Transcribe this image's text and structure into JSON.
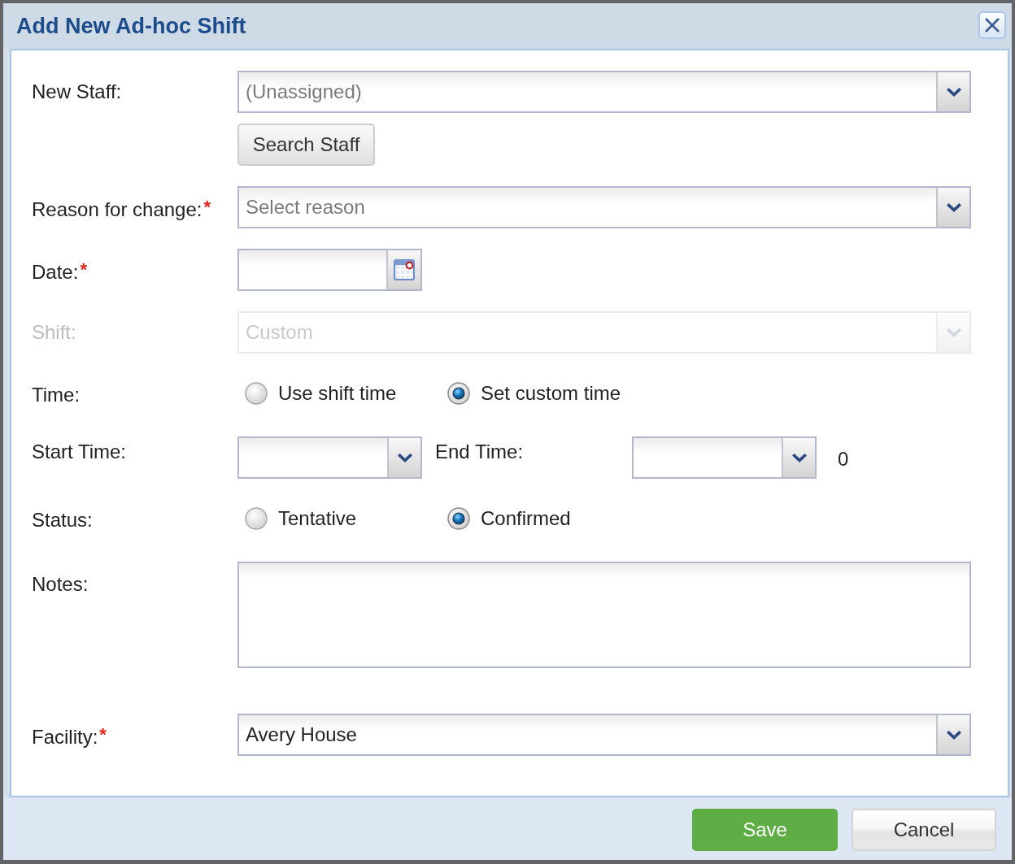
{
  "window": {
    "title": "Add New Ad-hoc Shift"
  },
  "form": {
    "fields": [
      {
        "kind": "dropdown",
        "label": "New Staff:",
        "placeholder": "(Unassigned)",
        "disabled": false,
        "button": "Search Staff"
      },
      {
        "kind": "dropdown",
        "label": "Reason for change:",
        "required_mark": "*",
        "placeholder": "Select reason",
        "disabled": false
      },
      {
        "kind": "date",
        "label": "Date:",
        "required_mark": "*",
        "disabled": false
      },
      {
        "kind": "dropdown",
        "label": "Shift:",
        "value": "Custom",
        "disabled": true
      },
      {
        "kind": "radio",
        "label": "Time:",
        "disabled": false,
        "options": [
          {
            "label": "Use shift time",
            "selected": false
          },
          {
            "label": "Set custom time",
            "selected": true
          }
        ]
      },
      {
        "kind": "time_range",
        "label": "Start Time:",
        "end_label": "End Time:",
        "trailing_value": "0",
        "disabled": false
      },
      {
        "kind": "radio",
        "label": "Status:",
        "disabled": false,
        "options": [
          {
            "label": "Tentative",
            "selected": false
          },
          {
            "label": "Confirmed",
            "selected": true
          }
        ]
      },
      {
        "kind": "textarea",
        "label": "Notes:",
        "disabled": false
      },
      {
        "kind": "dropdown",
        "label": "Facility:",
        "required_mark": "*",
        "value": "Avery House",
        "disabled": false
      }
    ]
  },
  "buttons": [
    {
      "kind": "primary",
      "label": "Save"
    },
    {
      "kind": "secondary",
      "label": "Cancel"
    }
  ]
}
